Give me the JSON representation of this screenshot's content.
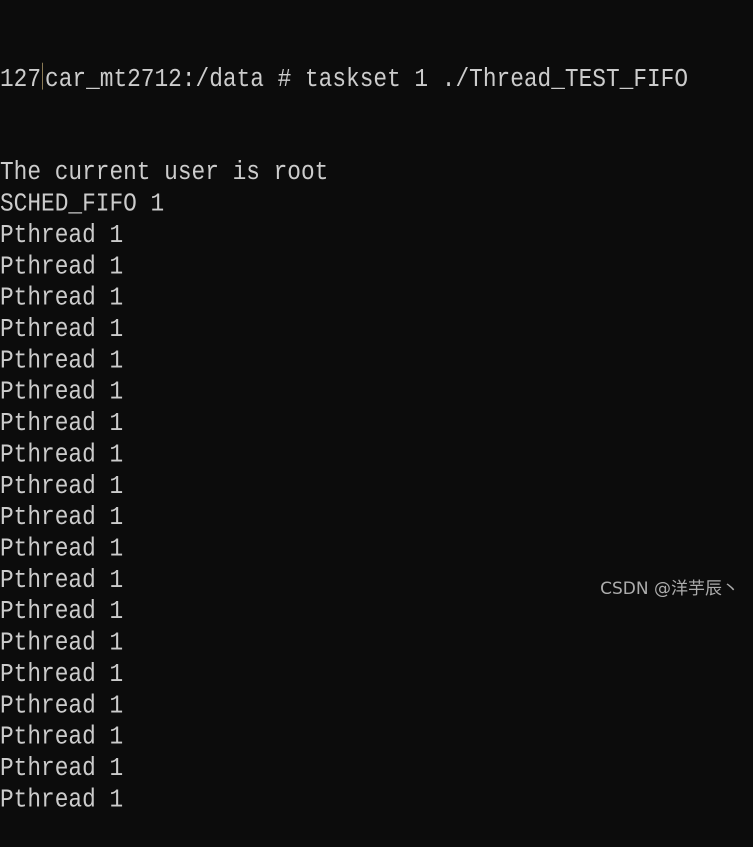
{
  "terminal": {
    "exit_code": "127",
    "prompt": "car_mt2712:/data # ",
    "command": "taskset 1 ./Thread_TEST_FIFO",
    "output": [
      "The current user is root",
      "SCHED_FIFO 1",
      "Pthread 1",
      "Pthread 1",
      "Pthread 1",
      "Pthread 1",
      "Pthread 1",
      "Pthread 1",
      "Pthread 1",
      "Pthread 1",
      "Pthread 1",
      "Pthread 1",
      "Pthread 1",
      "Pthread 1",
      "Pthread 1",
      "Pthread 1",
      "Pthread 1",
      "Pthread 1",
      "Pthread 1",
      "Pthread 1",
      "Pthread 1"
    ]
  },
  "watermark": "CSDN @洋芋辰丶",
  "colors": {
    "background": "#0c0c0c",
    "foreground": "#cccccc"
  }
}
